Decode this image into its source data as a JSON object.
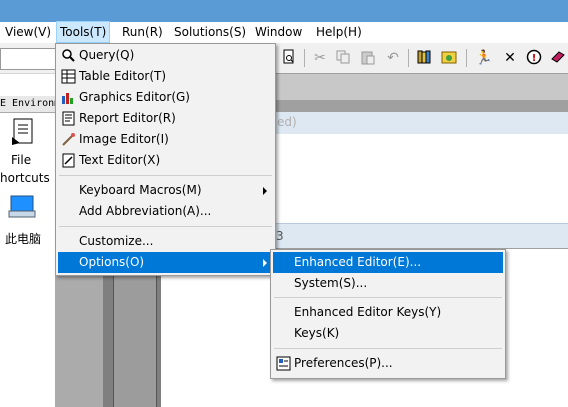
{
  "menubar": {
    "items": [
      {
        "label": "View(V)"
      },
      {
        "label": "Tools(T)"
      },
      {
        "label": "Run(R)"
      },
      {
        "label": "Solutions(S)"
      },
      {
        "label": "Window"
      },
      {
        "label": "Help(H)"
      }
    ]
  },
  "left_panel": {
    "env_label": "E Environm",
    "shortcut_label_1": "File",
    "shortcut_label_2": "hortcuts",
    "pc_label": "此电脑"
  },
  "background": {
    "faded_text": "ed)",
    "tab_fragment": "3"
  },
  "tools_menu": {
    "items": [
      {
        "label": "Query(Q)",
        "icon": "query-icon"
      },
      {
        "label": "Table Editor(T)",
        "icon": "table-editor-icon"
      },
      {
        "label": "Graphics Editor(G)",
        "icon": "graphics-editor-icon"
      },
      {
        "label": "Report Editor(R)",
        "icon": "report-editor-icon"
      },
      {
        "label": "Image Editor(I)",
        "icon": "image-editor-icon"
      },
      {
        "label": "Text Editor(X)",
        "icon": "text-editor-icon"
      },
      {
        "label": "Keyboard Macros(M)"
      },
      {
        "label": "Add Abbreviation(A)..."
      },
      {
        "label": "Customize..."
      },
      {
        "label": "Options(O)"
      }
    ]
  },
  "options_submenu": {
    "items": [
      {
        "label": "Enhanced Editor(E)..."
      },
      {
        "label": "System(S)..."
      },
      {
        "label": "Enhanced Editor Keys(Y)"
      },
      {
        "label": "Keys(K)"
      },
      {
        "label": "Preferences(P)...",
        "icon": "preferences-icon"
      }
    ]
  },
  "colors": {
    "highlight": "#0078d7",
    "menubar_open": "#cce8ff",
    "title_strip": "#5b9bd5"
  }
}
